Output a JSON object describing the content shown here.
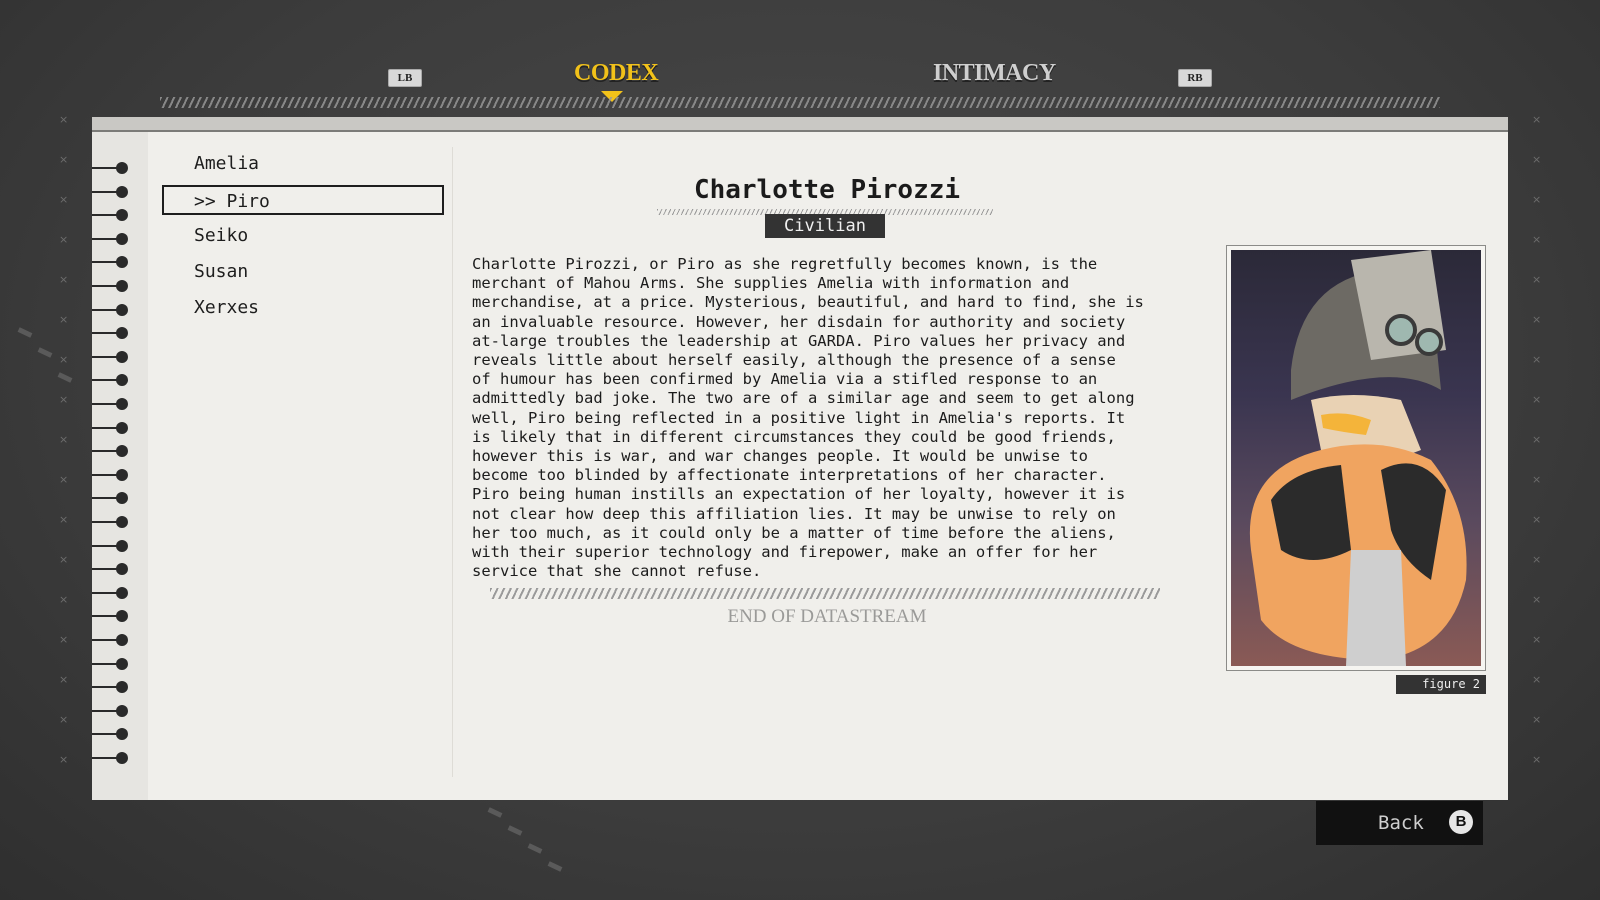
{
  "tabs": {
    "left_key": "LB",
    "right_key": "RB",
    "items": [
      {
        "label": "CODEX",
        "active": true
      },
      {
        "label": "INTIMACY",
        "active": false
      }
    ]
  },
  "characters": [
    {
      "label": "Amelia",
      "selected": false
    },
    {
      "label": ">> Piro",
      "selected": true
    },
    {
      "label": "Seiko",
      "selected": false
    },
    {
      "label": "Susan",
      "selected": false
    },
    {
      "label": "Xerxes",
      "selected": false
    }
  ],
  "entry": {
    "name": "Charlotte Pirozzi",
    "role": "Civilian",
    "bio": "Charlotte Pirozzi, or Piro as she regretfully becomes known, is the\nmerchant of Mahou Arms. She supplies Amelia with information and\nmerchandise, at a price. Mysterious, beautiful, and hard to find, she is\nan invaluable resource. However, her disdain for authority and society\nat-large troubles the leadership at GARDA.  Piro values her privacy and\nreveals little about herself easily, although the presence of a sense\nof humour has been confirmed by Amelia via a stifled response to an\nadmittedly bad joke. The two are of a similar age and seem to get along\nwell, Piro being reflected in a positive light in Amelia's reports. It\nis likely that in different circumstances they could be good friends,\nhowever this is war, and war changes people. It would be unwise to\nbecome too blinded by affectionate interpretations of her character.\nPiro being human instills an expectation of her loyalty, however it is\nnot clear how deep this affiliation lies. It may be unwise to rely on\nher too much, as it could only be a matter of time before the aliens,\nwith their superior technology and firepower, make an offer for her\nservice that she cannot refuse.",
    "end_label": "END OF DATASTREAM",
    "figure_label": "figure 2"
  },
  "footer": {
    "back_label": "Back",
    "back_key": "B"
  },
  "colors": {
    "accent": "#f2c21a",
    "panel": "#f0efeb",
    "dark": "#333333"
  }
}
